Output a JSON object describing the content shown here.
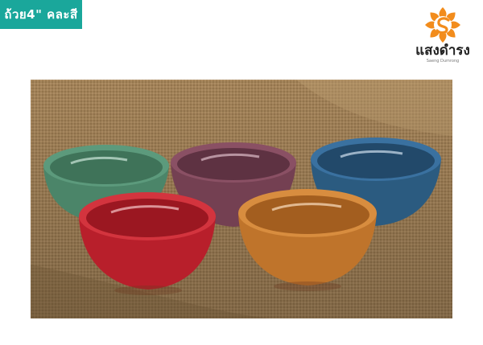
{
  "tag": {
    "label": "ถ้วย4\" คละสี",
    "color": "#1aa79b"
  },
  "logo": {
    "name": "แสงดำรง",
    "subtitle": "Saeng Dumrong",
    "color": "#f28c1c"
  },
  "photo": {
    "background": "burlap-cloth",
    "bowls": [
      {
        "color": "green",
        "hex": "#4f8a6e"
      },
      {
        "color": "purple",
        "hex": "#7a4354"
      },
      {
        "color": "blue",
        "hex": "#2f6288"
      },
      {
        "color": "red",
        "hex": "#c0232e"
      },
      {
        "color": "orange",
        "hex": "#c47a2f"
      }
    ]
  }
}
